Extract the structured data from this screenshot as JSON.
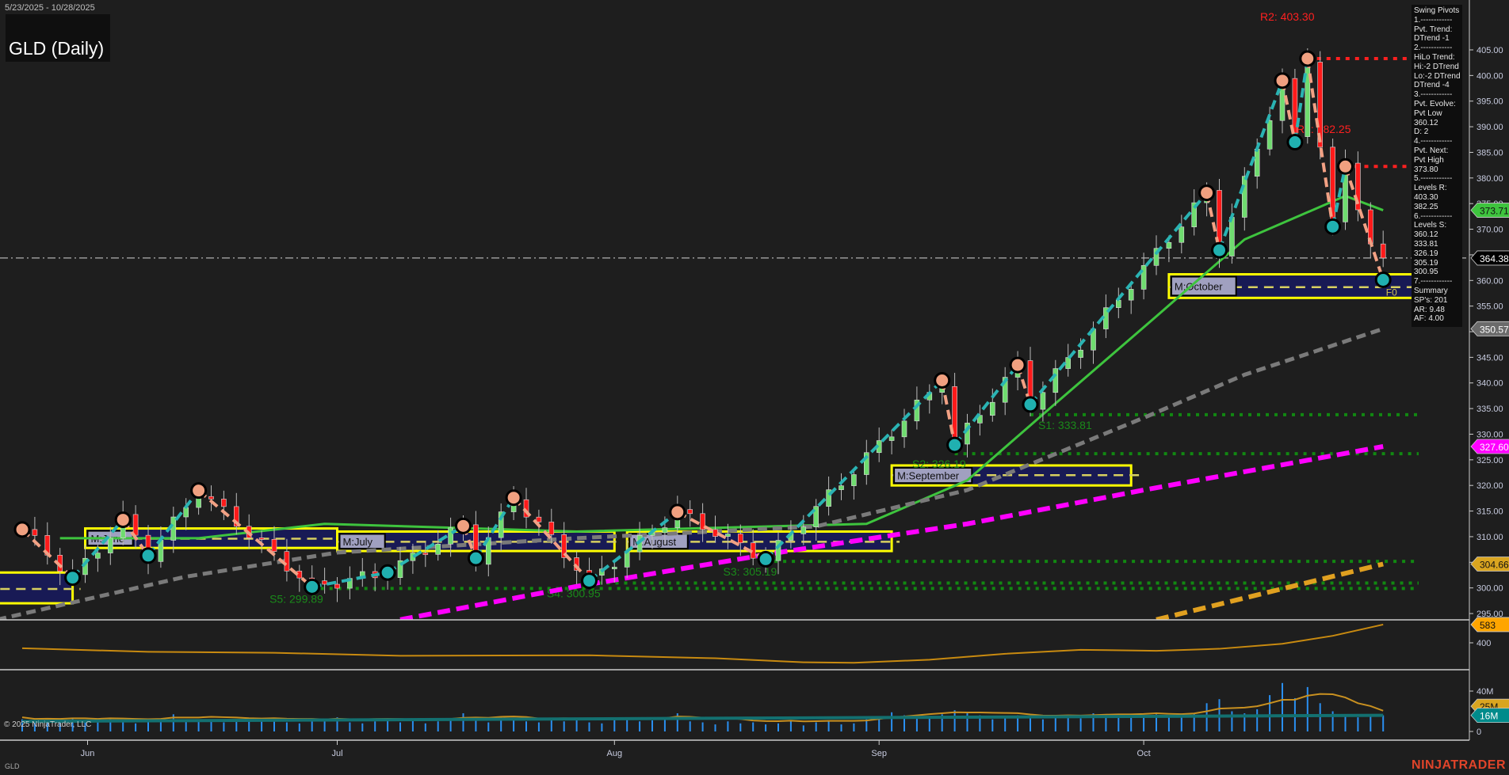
{
  "header": {
    "date_range": "5/23/2025 - 10/28/2025",
    "title": "GLD (Daily)"
  },
  "footer": {
    "copyright": "© 2025 NinjaTrader, LLC",
    "symbol": "GLD",
    "brand": "NINJATRADER"
  },
  "info_panel": {
    "lines": [
      "Swing Pivots",
      "1.------------",
      "Pvt. Trend:",
      "DTrend -1",
      "2.------------",
      "HiLo Trend:",
      "Hi:-2 DTrend",
      "Lo:-2 DTrend",
      "DTrend -4",
      "3.------------",
      "Pvt. Evolve:",
      "Pvt Low",
      "360.12",
      "D: 2",
      "4.------------",
      "Pvt. Next:",
      "Pvt High",
      "373.80",
      "5.------------",
      "Levels R:",
      "403.30",
      "382.25",
      "6.------------",
      "Levels S:",
      "360.12",
      "333.81",
      "326.19",
      "305.19",
      "300.95",
      "7.------------",
      "Summary",
      "SP's: 201",
      "AR: 9.48",
      "AF: 4.00"
    ]
  },
  "colors": {
    "background": "#1e1e1e",
    "up": "#6fdc6f",
    "down": "#ff1a1a",
    "zig_up": "#2ab3b3",
    "zig_down": "#f2a184",
    "ma_fast": "#3ec43e",
    "ma_mid": "#7a7a7a",
    "ma_slow": "#ff00ff",
    "ma_long": "#e0a020",
    "support": "#118811",
    "resistance": "#ff2020",
    "box_fill": "#181a55",
    "box_border": "#ffff00",
    "volume": "#2a8ff0"
  },
  "chart_data": {
    "type": "candlestick",
    "title": "GLD (Daily)",
    "ylim": [
      292,
      409
    ],
    "y_ticks": [
      "295.00",
      "300.00",
      "305.00",
      "310.00",
      "315.00",
      "320.00",
      "325.00",
      "330.00",
      "335.00",
      "340.00",
      "345.00",
      "350.00",
      "355.00",
      "360.00",
      "365.00",
      "370.00",
      "375.00",
      "380.00",
      "385.00",
      "390.00",
      "395.00",
      "400.00",
      "405.00"
    ],
    "x_ticks": [
      {
        "label": "Jun",
        "bar": 5
      },
      {
        "label": "Jul",
        "bar": 25
      },
      {
        "label": "Aug",
        "bar": 47
      },
      {
        "label": "Sep",
        "bar": 68
      },
      {
        "label": "Oct",
        "bar": 89
      }
    ],
    "last_price": "364.38",
    "swing_pivots": [
      {
        "bar": 0,
        "price": 311.4,
        "type": "high"
      },
      {
        "bar": 4,
        "price": 302.0,
        "type": "low"
      },
      {
        "bar": 8,
        "price": 313.3,
        "type": "high"
      },
      {
        "bar": 10,
        "price": 306.3,
        "type": "low"
      },
      {
        "bar": 14,
        "price": 319.0,
        "type": "high"
      },
      {
        "bar": 23,
        "price": 300.2,
        "type": "low"
      },
      {
        "bar": 29,
        "price": 303.0,
        "type": "low"
      },
      {
        "bar": 35,
        "price": 312.1,
        "type": "high"
      },
      {
        "bar": 36,
        "price": 305.8,
        "type": "low"
      },
      {
        "bar": 39,
        "price": 317.6,
        "type": "high"
      },
      {
        "bar": 45,
        "price": 301.4,
        "type": "low"
      },
      {
        "bar": 52,
        "price": 314.8,
        "type": "high"
      },
      {
        "bar": 59,
        "price": 305.6,
        "type": "low"
      },
      {
        "bar": 73,
        "price": 340.5,
        "type": "high"
      },
      {
        "bar": 74,
        "price": 327.9,
        "type": "low"
      },
      {
        "bar": 79,
        "price": 343.5,
        "type": "high"
      },
      {
        "bar": 80,
        "price": 335.8,
        "type": "low"
      },
      {
        "bar": 94,
        "price": 377.1,
        "type": "high"
      },
      {
        "bar": 95,
        "price": 365.9,
        "type": "low"
      },
      {
        "bar": 100,
        "price": 399.0,
        "type": "high"
      },
      {
        "bar": 101,
        "price": 387.0,
        "type": "low"
      },
      {
        "bar": 102,
        "price": 403.3,
        "type": "high"
      },
      {
        "bar": 104,
        "price": 370.5,
        "type": "low"
      },
      {
        "bar": 105,
        "price": 382.25,
        "type": "high"
      },
      {
        "bar": 108,
        "price": 360.12,
        "type": "low"
      }
    ],
    "resistance_levels": [
      {
        "label": "R2: 403.30",
        "price": 403.3,
        "from_bar": 102
      },
      {
        "label": "R1: 382.25",
        "price": 382.25,
        "from_bar": 105
      }
    ],
    "support_levels": [
      {
        "label": "S1: 333.81",
        "price": 333.81,
        "from_bar": 80,
        "label_bar": 80
      },
      {
        "label": "S2: 326.19",
        "price": 326.19,
        "from_bar": 74,
        "label_bar": 70
      },
      {
        "label": "S3: 305.19",
        "price": 305.19,
        "from_bar": 59,
        "label_bar": 55
      },
      {
        "label": "S4: 300.95",
        "price": 300.95,
        "from_bar": 45,
        "label_bar": 41
      },
      {
        "label": "S5: 299.89",
        "price": 299.89,
        "from_bar": 23,
        "label_bar": 19
      }
    ],
    "monthly_boxes": [
      {
        "label": "",
        "from_bar": -3,
        "to_bar": 4,
        "top": 303.0,
        "bottom": 297.0,
        "mid": 299.8
      },
      {
        "label": "M:June",
        "from_bar": 5,
        "to_bar": 25,
        "top": 311.6,
        "bottom": 307.8,
        "mid": 309.6
      },
      {
        "label": "M:July",
        "from_bar": 25,
        "to_bar": 47,
        "top": 311.0,
        "bottom": 307.2,
        "mid": 309.0
      },
      {
        "label": "M:August",
        "from_bar": 48,
        "to_bar": 69,
        "top": 311.0,
        "bottom": 307.2,
        "mid": 309.0
      },
      {
        "label": "M:September",
        "from_bar": 69,
        "to_bar": 88,
        "top": 323.9,
        "bottom": 320.0,
        "mid": 322.0
      },
      {
        "label": "M:October",
        "from_bar": 91,
        "to_bar": 112,
        "top": 361.2,
        "bottom": 356.6,
        "mid": 358.7,
        "tag": "F0"
      }
    ],
    "moving_averages": [
      {
        "name": "fast",
        "last": "373.71",
        "points": [
          [
            3,
            309.7
          ],
          [
            14,
            309.7
          ],
          [
            24,
            312.5
          ],
          [
            44,
            311
          ],
          [
            67,
            312.5
          ],
          [
            75,
            321
          ],
          [
            82,
            336
          ],
          [
            90,
            353
          ],
          [
            97,
            368
          ],
          [
            105,
            376.5
          ],
          [
            108,
            373.71
          ]
        ]
      },
      {
        "name": "mid",
        "last": "350.57",
        "points": [
          [
            -2,
            293.8
          ],
          [
            13,
            302.2
          ],
          [
            25,
            306.9
          ],
          [
            44,
            309.7
          ],
          [
            63,
            312
          ],
          [
            75,
            319.1
          ],
          [
            89,
            333.2
          ],
          [
            97,
            341.6
          ],
          [
            108,
            350.57
          ]
        ]
      },
      {
        "name": "slow",
        "last": "327.60",
        "points": [
          [
            30,
            293.8
          ],
          [
            44,
            300.3
          ],
          [
            60,
            306.9
          ],
          [
            75,
            312.5
          ],
          [
            89,
            319.1
          ],
          [
            108,
            327.6
          ]
        ]
      },
      {
        "name": "long",
        "last": "304.66",
        "points": [
          [
            90,
            293.8
          ],
          [
            108,
            304.66
          ]
        ]
      }
    ],
    "indicator": {
      "last": "583",
      "tick": "400",
      "points": [
        [
          0,
          345
        ],
        [
          10,
          310
        ],
        [
          20,
          300
        ],
        [
          30,
          270
        ],
        [
          45,
          275
        ],
        [
          55,
          245
        ],
        [
          62,
          205
        ],
        [
          66,
          200
        ],
        [
          72,
          230
        ],
        [
          78,
          290
        ],
        [
          84,
          330
        ],
        [
          90,
          320
        ],
        [
          95,
          340
        ],
        [
          100,
          390
        ],
        [
          104,
          470
        ],
        [
          108,
          583
        ]
      ]
    },
    "volume": {
      "ticks": [
        "0",
        "40M"
      ],
      "last": "16M",
      "avg_last": "25M",
      "unit": "M",
      "values": [
        12,
        9,
        11,
        10,
        13,
        11,
        9,
        12,
        10,
        8,
        11,
        13,
        17,
        12,
        10,
        12,
        9,
        11,
        13,
        10,
        12,
        9,
        8,
        11,
        10,
        14,
        9,
        8,
        10,
        12,
        9,
        11,
        8,
        10,
        13,
        18,
        11,
        9,
        14,
        12,
        10,
        9,
        11,
        10,
        13,
        9,
        8,
        12,
        14,
        10,
        11,
        12,
        18,
        10,
        9,
        7,
        10,
        8,
        9,
        7,
        8,
        10,
        6,
        9,
        11,
        7,
        8,
        12,
        15,
        19,
        16,
        14,
        15,
        17,
        21,
        18,
        16,
        12,
        14,
        16,
        13,
        12,
        15,
        14,
        13,
        18,
        16,
        14,
        15,
        16,
        17,
        15,
        14,
        18,
        28,
        32,
        20,
        18,
        22,
        36,
        48,
        33,
        44,
        28,
        20,
        17,
        14,
        16,
        16
      ]
    }
  }
}
